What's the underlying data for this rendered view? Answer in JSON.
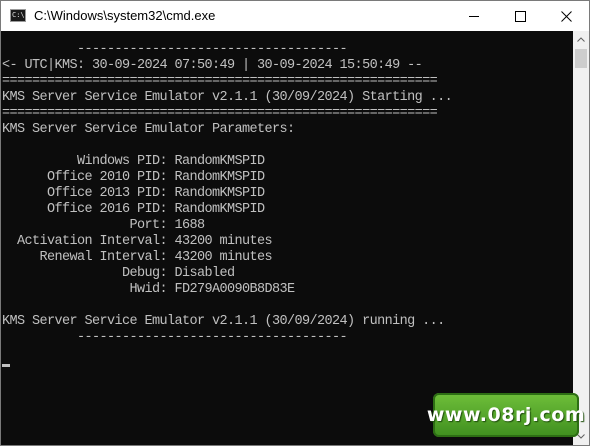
{
  "window": {
    "title": "C:\\Windows\\system32\\cmd.exe",
    "icon_label": "C:\\."
  },
  "console": {
    "lines": [
      "          ------------------------------------",
      "<- UTC|KMS: 30-09-2024 07:50:49 | 30-09-2024 15:50:49 --",
      "==========================================================",
      "KMS Server Service Emulator v2.1.1 (30/09/2024) Starting ...",
      "==========================================================",
      "KMS Server Service Emulator Parameters:",
      "",
      "          Windows PID: RandomKMSPID",
      "      Office 2010 PID: RandomKMSPID",
      "      Office 2013 PID: RandomKMSPID",
      "      Office 2016 PID: RandomKMSPID",
      "                 Port: 1688",
      "  Activation Interval: 43200 minutes",
      "     Renewal Interval: 43200 minutes",
      "                Debug: Disabled",
      "                 Hwid: FD279A0090B8D83E",
      "",
      "KMS Server Service Emulator v2.1.1 (30/09/2024) running ...",
      "          ------------------------------------"
    ]
  },
  "watermark": {
    "text": "www.08rj.com"
  },
  "colors": {
    "console_bg": "#0c0c0c",
    "console_fg": "#c0c0c0",
    "titlebar_bg": "#ffffff",
    "watermark_bg": "#4fa52a"
  },
  "icons": {
    "minimize": "minimize-icon",
    "maximize": "maximize-icon",
    "close": "close-icon",
    "scroll_up": "chevron-up-icon",
    "scroll_down": "chevron-down-icon"
  }
}
